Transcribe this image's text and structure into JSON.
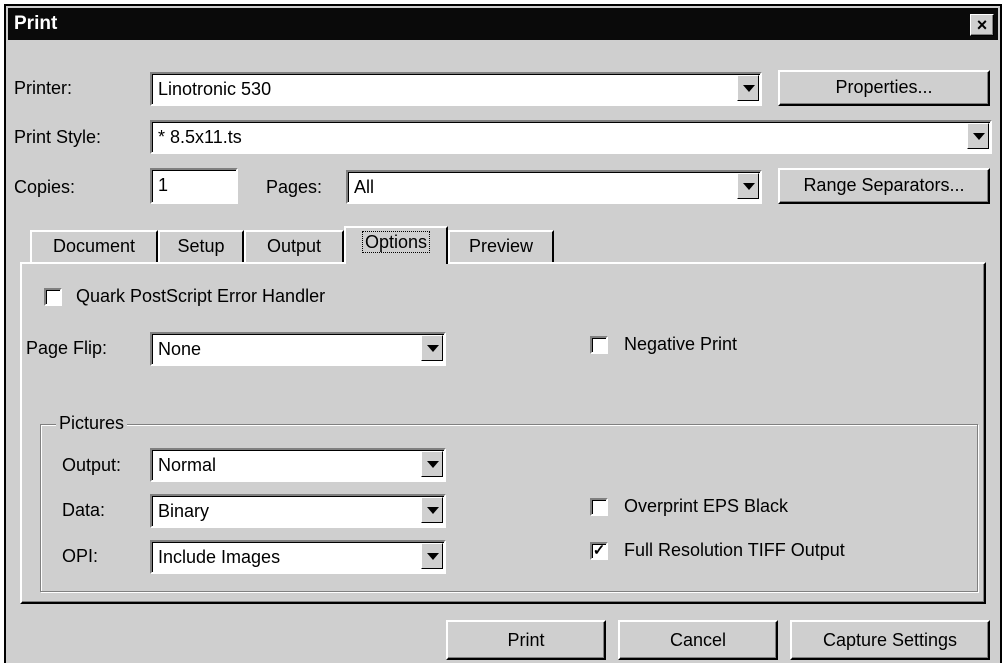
{
  "window": {
    "title": "Print",
    "close_glyph": "×"
  },
  "printer": {
    "label": "Printer:",
    "value": "Linotronic 530",
    "properties_button": "Properties..."
  },
  "print_style": {
    "label": "Print Style:",
    "value": "* 8.5x11.ts"
  },
  "copies": {
    "label": "Copies:",
    "value": "1"
  },
  "pages": {
    "label": "Pages:",
    "value": "All",
    "range_button": "Range Separators..."
  },
  "tabs": [
    {
      "label": "Document"
    },
    {
      "label": "Setup"
    },
    {
      "label": "Output"
    },
    {
      "label": "Options",
      "active": true
    },
    {
      "label": "Preview"
    }
  ],
  "options": {
    "error_handler": {
      "label": "Quark PostScript Error Handler",
      "checked": false
    },
    "page_flip": {
      "label": "Page Flip:",
      "value": "None"
    },
    "negative_print": {
      "label": "Negative Print",
      "checked": false
    },
    "pictures": {
      "title": "Pictures",
      "output": {
        "label": "Output:",
        "value": "Normal"
      },
      "data": {
        "label": "Data:",
        "value": "Binary"
      },
      "opi": {
        "label": "OPI:",
        "value": "Include Images"
      },
      "overprint_eps_black": {
        "label": "Overprint EPS Black",
        "checked": false
      },
      "full_res_tiff": {
        "label": "Full Resolution TIFF Output",
        "checked": true
      }
    }
  },
  "buttons": {
    "print": "Print",
    "cancel": "Cancel",
    "capture": "Capture Settings"
  },
  "colors": {
    "face": "#cfcfcf",
    "titlebar": "#0a0a0a",
    "field": "#ffffff"
  }
}
